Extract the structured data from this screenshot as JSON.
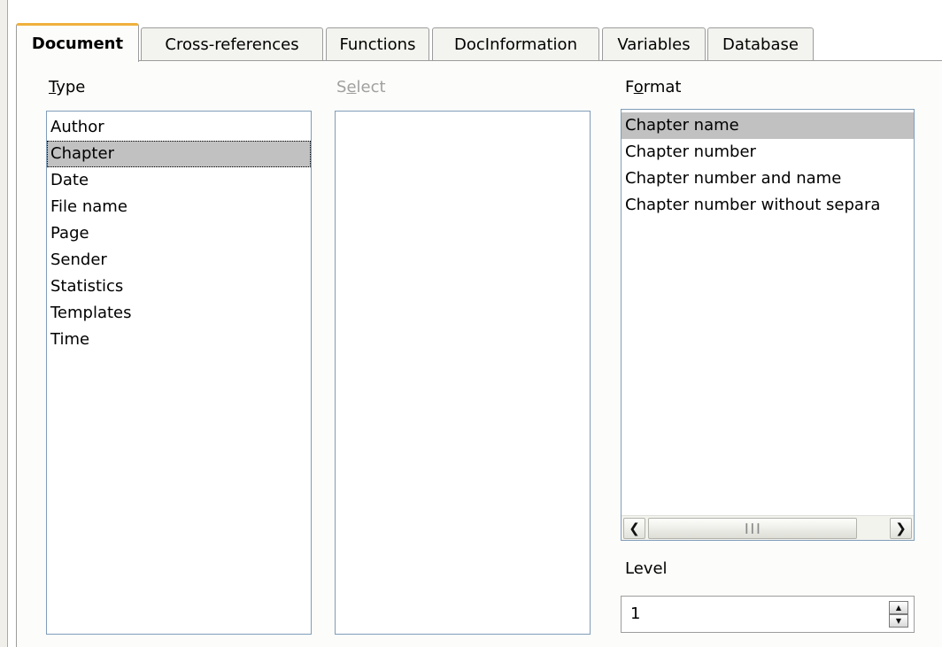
{
  "tabs": [
    {
      "label": "Document",
      "active": true
    },
    {
      "label": "Cross-references",
      "active": false
    },
    {
      "label": "Functions",
      "active": false
    },
    {
      "label": "DocInformation",
      "active": false
    },
    {
      "label": "Variables",
      "active": false
    },
    {
      "label": "Database",
      "active": false
    }
  ],
  "type": {
    "label_mnemonic": "T",
    "label_rest": "ype",
    "items": [
      "Author",
      "Chapter",
      "Date",
      "File name",
      "Page",
      "Sender",
      "Statistics",
      "Templates",
      "Time"
    ],
    "selected": "Chapter"
  },
  "select": {
    "label_pre": "S",
    "label_mnemonic": "e",
    "label_rest": "lect",
    "disabled": true,
    "items": []
  },
  "format": {
    "label_pre": "F",
    "label_mnemonic": "o",
    "label_rest": "rmat",
    "items": [
      "Chapter name",
      "Chapter number",
      "Chapter number and name",
      "Chapter number without separa"
    ],
    "selected": "Chapter name"
  },
  "level": {
    "label": "Level",
    "value": "1"
  },
  "icons": {
    "scroll_left": "chevron-left-icon",
    "scroll_right": "chevron-right-icon",
    "thumb_grip": "grip-icon",
    "spin_up": "triangle-up-icon",
    "spin_down": "triangle-down-icon"
  },
  "colors": {
    "active_tab_accent": "#f0b03c",
    "selection": "#c1c1c1",
    "list_border": "#7f9db9"
  }
}
